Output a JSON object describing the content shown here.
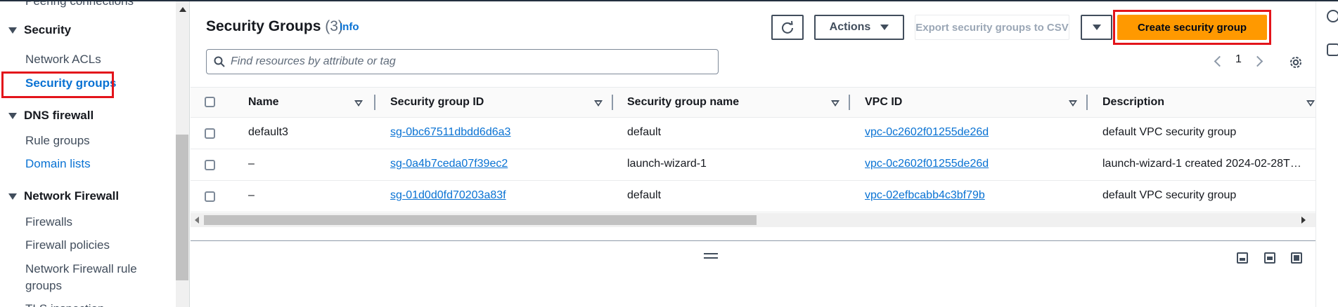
{
  "sidebar": {
    "cut_item": "Peering connections",
    "sections": [
      {
        "title": "Security",
        "items": [
          {
            "label": "Network ACLs"
          },
          {
            "label": "Security groups"
          }
        ]
      },
      {
        "title": "DNS firewall",
        "items": [
          {
            "label": "Rule groups"
          },
          {
            "label": "Domain lists"
          }
        ]
      },
      {
        "title": "Network Firewall",
        "items": [
          {
            "label": "Firewalls"
          },
          {
            "label": "Firewall policies"
          },
          {
            "label": "Network Firewall rule"
          },
          {
            "label": "groups"
          }
        ]
      }
    ],
    "cut_bottom_item": "TLS inspection",
    "active_item": "Security groups"
  },
  "header": {
    "title": "Security Groups",
    "count": "(3)",
    "info_label": "Info"
  },
  "toolbar": {
    "refresh_icon": "refresh-icon",
    "actions_label": "Actions",
    "export_label": "Export security groups to CSV",
    "create_label": "Create security group"
  },
  "search": {
    "placeholder": "Find resources by attribute or tag"
  },
  "pagination": {
    "current_page": "1"
  },
  "table": {
    "columns": [
      "Name",
      "Security group ID",
      "Security group name",
      "VPC ID",
      "Description"
    ],
    "rows": [
      {
        "name": "default3",
        "group_id": "sg-0bc67511dbdd6d6a3",
        "group_name": "default",
        "vpc_id": "vpc-0c2602f01255de26d",
        "description": "default VPC security group"
      },
      {
        "name": "–",
        "group_id": "sg-0a4b7ceda07f39ec2",
        "group_name": "launch-wizard-1",
        "vpc_id": "vpc-0c2602f01255de26d",
        "description": "launch-wizard-1 created 2024-02-28T…"
      },
      {
        "name": "–",
        "group_id": "sg-01d0d0fd70203a83f",
        "group_name": "default",
        "vpc_id": "vpc-02efbcabb4c3bf79b",
        "description": "default VPC security group"
      }
    ]
  },
  "colors": {
    "accent_link": "#0972d3",
    "primary_button": "#ff9900",
    "highlight_box": "#e3141b"
  }
}
